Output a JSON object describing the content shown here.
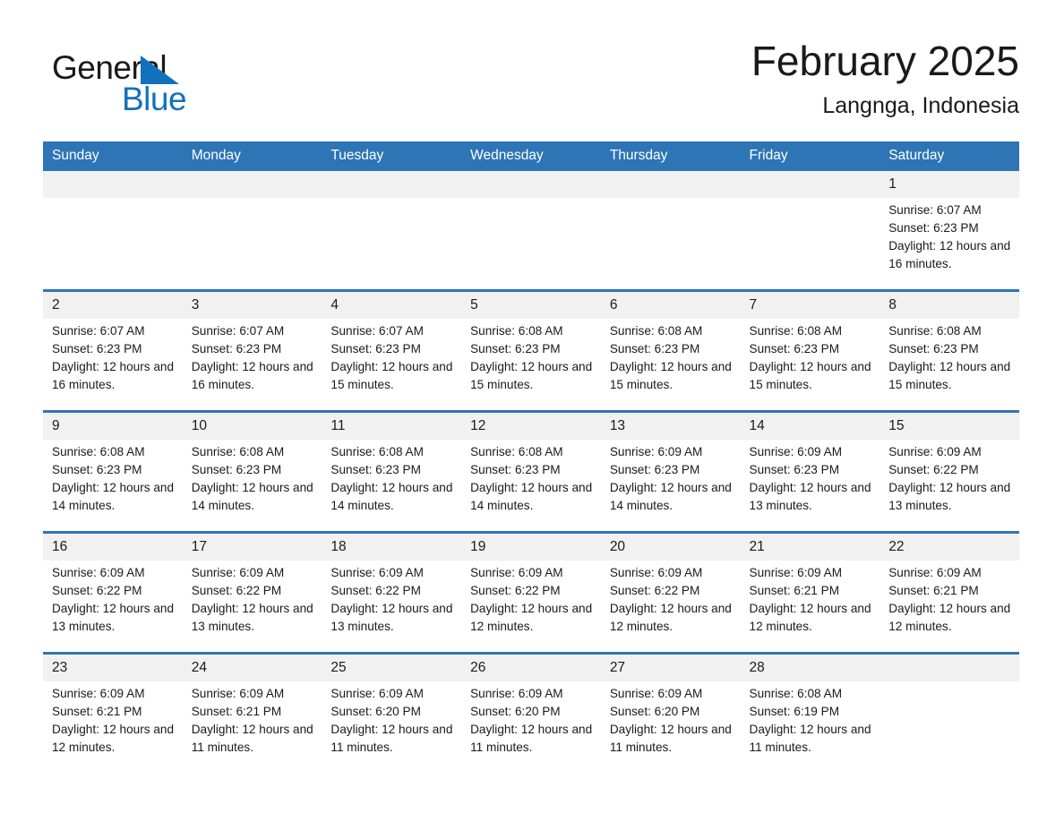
{
  "brand": {
    "line1": "General",
    "line2": "Blue",
    "triangle_icon": "triangle-icon",
    "blue": "#1271bd"
  },
  "header": {
    "month_title": "February 2025",
    "location": "Langnga, Indonesia"
  },
  "calendar": {
    "accent_color": "#2e75b6",
    "daynum_bg": "#f1f1f1",
    "weekday_headers": [
      "Sunday",
      "Monday",
      "Tuesday",
      "Wednesday",
      "Thursday",
      "Friday",
      "Saturday"
    ],
    "weeks": [
      [
        {
          "day": "",
          "blank": true
        },
        {
          "day": "",
          "blank": true
        },
        {
          "day": "",
          "blank": true
        },
        {
          "day": "",
          "blank": true
        },
        {
          "day": "",
          "blank": true
        },
        {
          "day": "",
          "blank": true
        },
        {
          "day": "1",
          "sunrise": "Sunrise: 6:07 AM",
          "sunset": "Sunset: 6:23 PM",
          "daylight": "Daylight: 12 hours and 16 minutes."
        }
      ],
      [
        {
          "day": "2",
          "sunrise": "Sunrise: 6:07 AM",
          "sunset": "Sunset: 6:23 PM",
          "daylight": "Daylight: 12 hours and 16 minutes."
        },
        {
          "day": "3",
          "sunrise": "Sunrise: 6:07 AM",
          "sunset": "Sunset: 6:23 PM",
          "daylight": "Daylight: 12 hours and 16 minutes."
        },
        {
          "day": "4",
          "sunrise": "Sunrise: 6:07 AM",
          "sunset": "Sunset: 6:23 PM",
          "daylight": "Daylight: 12 hours and 15 minutes."
        },
        {
          "day": "5",
          "sunrise": "Sunrise: 6:08 AM",
          "sunset": "Sunset: 6:23 PM",
          "daylight": "Daylight: 12 hours and 15 minutes."
        },
        {
          "day": "6",
          "sunrise": "Sunrise: 6:08 AM",
          "sunset": "Sunset: 6:23 PM",
          "daylight": "Daylight: 12 hours and 15 minutes."
        },
        {
          "day": "7",
          "sunrise": "Sunrise: 6:08 AM",
          "sunset": "Sunset: 6:23 PM",
          "daylight": "Daylight: 12 hours and 15 minutes."
        },
        {
          "day": "8",
          "sunrise": "Sunrise: 6:08 AM",
          "sunset": "Sunset: 6:23 PM",
          "daylight": "Daylight: 12 hours and 15 minutes."
        }
      ],
      [
        {
          "day": "9",
          "sunrise": "Sunrise: 6:08 AM",
          "sunset": "Sunset: 6:23 PM",
          "daylight": "Daylight: 12 hours and 14 minutes."
        },
        {
          "day": "10",
          "sunrise": "Sunrise: 6:08 AM",
          "sunset": "Sunset: 6:23 PM",
          "daylight": "Daylight: 12 hours and 14 minutes."
        },
        {
          "day": "11",
          "sunrise": "Sunrise: 6:08 AM",
          "sunset": "Sunset: 6:23 PM",
          "daylight": "Daylight: 12 hours and 14 minutes."
        },
        {
          "day": "12",
          "sunrise": "Sunrise: 6:08 AM",
          "sunset": "Sunset: 6:23 PM",
          "daylight": "Daylight: 12 hours and 14 minutes."
        },
        {
          "day": "13",
          "sunrise": "Sunrise: 6:09 AM",
          "sunset": "Sunset: 6:23 PM",
          "daylight": "Daylight: 12 hours and 14 minutes."
        },
        {
          "day": "14",
          "sunrise": "Sunrise: 6:09 AM",
          "sunset": "Sunset: 6:23 PM",
          "daylight": "Daylight: 12 hours and 13 minutes."
        },
        {
          "day": "15",
          "sunrise": "Sunrise: 6:09 AM",
          "sunset": "Sunset: 6:22 PM",
          "daylight": "Daylight: 12 hours and 13 minutes."
        }
      ],
      [
        {
          "day": "16",
          "sunrise": "Sunrise: 6:09 AM",
          "sunset": "Sunset: 6:22 PM",
          "daylight": "Daylight: 12 hours and 13 minutes."
        },
        {
          "day": "17",
          "sunrise": "Sunrise: 6:09 AM",
          "sunset": "Sunset: 6:22 PM",
          "daylight": "Daylight: 12 hours and 13 minutes."
        },
        {
          "day": "18",
          "sunrise": "Sunrise: 6:09 AM",
          "sunset": "Sunset: 6:22 PM",
          "daylight": "Daylight: 12 hours and 13 minutes."
        },
        {
          "day": "19",
          "sunrise": "Sunrise: 6:09 AM",
          "sunset": "Sunset: 6:22 PM",
          "daylight": "Daylight: 12 hours and 12 minutes."
        },
        {
          "day": "20",
          "sunrise": "Sunrise: 6:09 AM",
          "sunset": "Sunset: 6:22 PM",
          "daylight": "Daylight: 12 hours and 12 minutes."
        },
        {
          "day": "21",
          "sunrise": "Sunrise: 6:09 AM",
          "sunset": "Sunset: 6:21 PM",
          "daylight": "Daylight: 12 hours and 12 minutes."
        },
        {
          "day": "22",
          "sunrise": "Sunrise: 6:09 AM",
          "sunset": "Sunset: 6:21 PM",
          "daylight": "Daylight: 12 hours and 12 minutes."
        }
      ],
      [
        {
          "day": "23",
          "sunrise": "Sunrise: 6:09 AM",
          "sunset": "Sunset: 6:21 PM",
          "daylight": "Daylight: 12 hours and 12 minutes."
        },
        {
          "day": "24",
          "sunrise": "Sunrise: 6:09 AM",
          "sunset": "Sunset: 6:21 PM",
          "daylight": "Daylight: 12 hours and 11 minutes."
        },
        {
          "day": "25",
          "sunrise": "Sunrise: 6:09 AM",
          "sunset": "Sunset: 6:20 PM",
          "daylight": "Daylight: 12 hours and 11 minutes."
        },
        {
          "day": "26",
          "sunrise": "Sunrise: 6:09 AM",
          "sunset": "Sunset: 6:20 PM",
          "daylight": "Daylight: 12 hours and 11 minutes."
        },
        {
          "day": "27",
          "sunrise": "Sunrise: 6:09 AM",
          "sunset": "Sunset: 6:20 PM",
          "daylight": "Daylight: 12 hours and 11 minutes."
        },
        {
          "day": "28",
          "sunrise": "Sunrise: 6:08 AM",
          "sunset": "Sunset: 6:19 PM",
          "daylight": "Daylight: 12 hours and 11 minutes."
        },
        {
          "day": "",
          "blank": true
        }
      ]
    ]
  }
}
